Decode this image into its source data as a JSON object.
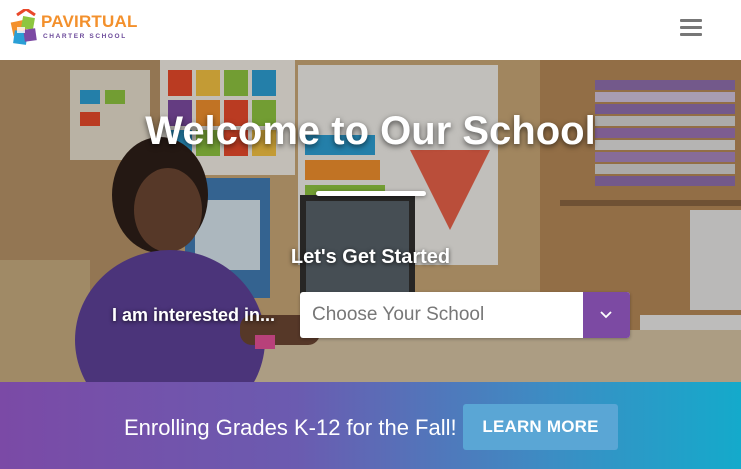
{
  "header": {
    "logo_name": "PAVIRTUAL",
    "logo_subtitle": "CHARTER SCHOOL",
    "menu_icon": "hamburger-menu-icon"
  },
  "hero": {
    "title": "Welcome to Our School",
    "subtitle": "Let's Get Started",
    "interest_label": "I am interested in...",
    "school_select": {
      "selected": "Choose Your School",
      "icon": "chevron-down-icon"
    }
  },
  "banner": {
    "text": "Enrolling Grades K-12 for the Fall!",
    "button_label": "LEARN MORE"
  },
  "colors": {
    "brand_orange": "#f3902c",
    "brand_purple": "#7c4aa3",
    "banner_gradient_start": "#7b4aa6",
    "banner_gradient_end": "#14aacb",
    "button_blue": "#5aa6d5"
  }
}
